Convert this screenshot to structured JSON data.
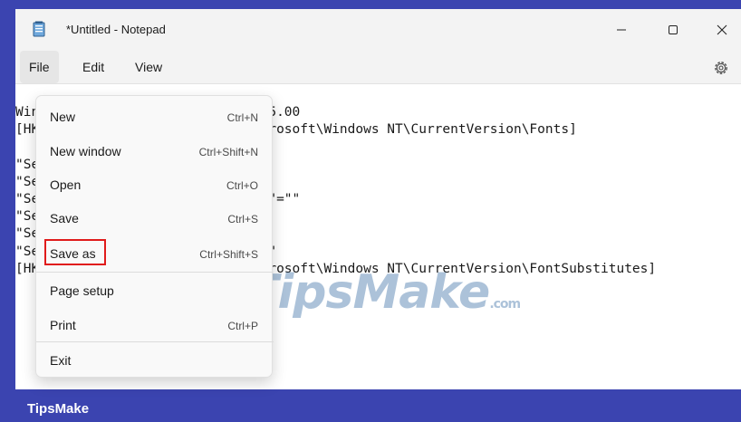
{
  "window": {
    "title": "*Untitled - Notepad"
  },
  "menubar": {
    "file": "File",
    "edit": "Edit",
    "view": "View"
  },
  "file_menu": [
    {
      "label": "New",
      "shortcut": "Ctrl+N"
    },
    {
      "label": "New window",
      "shortcut": "Ctrl+Shift+N"
    },
    {
      "label": "Open",
      "shortcut": "Ctrl+O"
    },
    {
      "label": "Save",
      "shortcut": "Ctrl+S"
    },
    {
      "label": "Save as",
      "shortcut": "Ctrl+Shift+S"
    },
    {
      "label": "Page setup",
      "shortcut": ""
    },
    {
      "label": "Print",
      "shortcut": "Ctrl+P"
    },
    {
      "label": "Exit",
      "shortcut": ""
    }
  ],
  "editor": {
    "lines": [
      "Windows Registry Editor Version 5.00",
      "[HKEY_LOCAL_MACHINE\\SOFTWARE\\Microsoft\\Windows NT\\CurrentVersion\\Fonts]",
      "",
      "\"Segoe UI (TrueType)\"=\"\"",
      "\"Segoe UI Bold (TrueType)\"=\"\"",
      "\"Segoe UI Bold Italic (TrueType)\"=\"\"",
      "\"Segoe UI Italic (TrueType)\"=\"\"",
      "\"Segoe UI Light (TrueType)\"=\"\"",
      "\"Segoe UI Semibold (TrueType)\"=\"\"",
      "[HKEY_LOCAL_MACHINE\\SOFTWARE\\Microsoft\\Windows NT\\CurrentVersion\\FontSubstitutes]"
    ]
  },
  "watermark": {
    "main": "TipsMake",
    "domain": ".com"
  },
  "brand": {
    "label": "TipsMake"
  },
  "colors": {
    "frame": "#3b44b0",
    "highlight": "#e01b1b"
  }
}
